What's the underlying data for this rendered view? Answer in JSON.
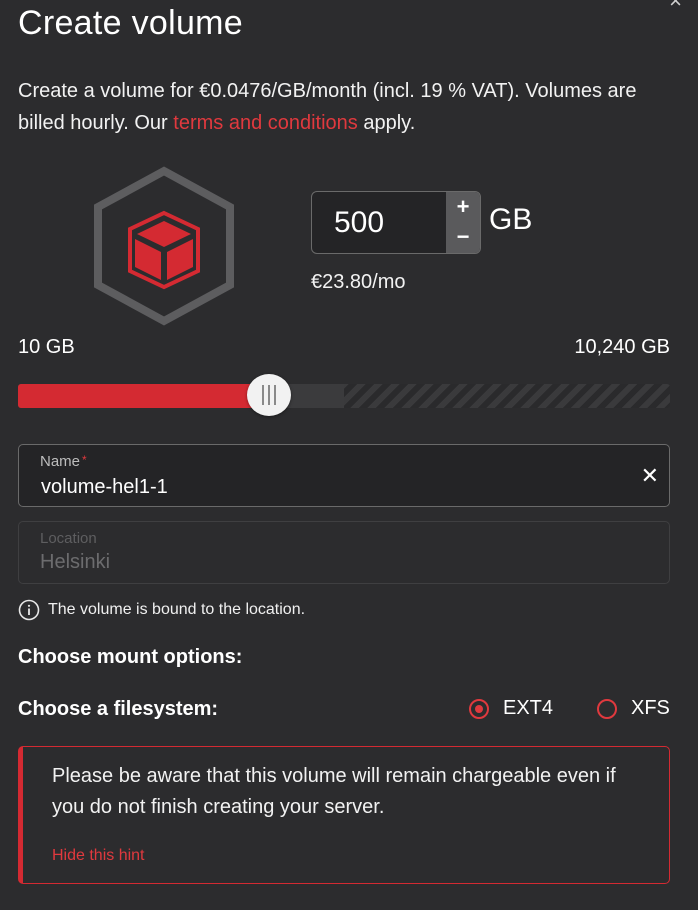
{
  "dialog": {
    "title": "Create volume",
    "close_icon": "close-icon"
  },
  "intro": {
    "text_before": "Create a volume for €0.0476/GB/month (incl. 19 % VAT). Volumes are billed hourly. Our ",
    "link_text": "terms and conditions",
    "text_after": " apply."
  },
  "size": {
    "value": "500",
    "unit": "GB",
    "price": "€23.80/mo",
    "plus": "+",
    "minus": "−"
  },
  "slider": {
    "min_label": "10 GB",
    "max_label": "10,240 GB",
    "fill_fraction": 0.385,
    "available_fraction": 0.5
  },
  "name_field": {
    "label": "Name",
    "required_mark": "*",
    "value": "volume-hel1-1"
  },
  "location_field": {
    "label": "Location",
    "value": "Helsinki"
  },
  "info": {
    "text": "The volume is bound to the location."
  },
  "mount": {
    "label": "Choose mount options:"
  },
  "filesystem": {
    "label": "Choose a filesystem:",
    "options": [
      {
        "label": "EXT4",
        "selected": true
      },
      {
        "label": "XFS",
        "selected": false
      }
    ]
  },
  "hint": {
    "text": "Please be aware that this volume will remain chargeable even if you do not finish creating your server.",
    "hide_label": "Hide this hint"
  },
  "colors": {
    "accent": "#d42a32",
    "background": "#2c2c2e"
  }
}
